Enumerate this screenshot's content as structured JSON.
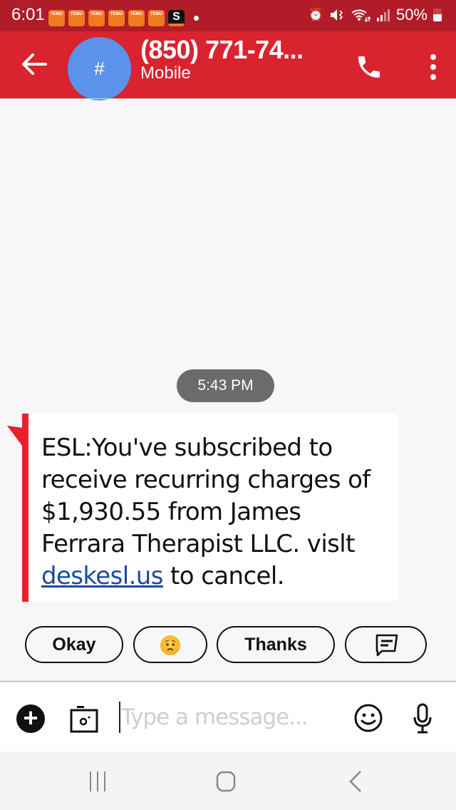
{
  "status_bar": {
    "time": "6:01",
    "notification_icons": [
      "temu-icon",
      "temu-icon",
      "temu-icon",
      "temu-icon",
      "temu-icon",
      "temu-icon",
      "s-tv-icon"
    ],
    "temu_label": "TEMU",
    "s_label": "S",
    "battery": "50%",
    "system_icons": [
      "alarm-icon",
      "mute-icon",
      "wifi-icon",
      "signal-icon",
      "battery-icon"
    ]
  },
  "header": {
    "avatar_text": "#",
    "title": "(850) 771-74...",
    "subtitle": "Mobile",
    "back_icon": "arrow-left-icon",
    "call_icon": "phone-icon",
    "more_icon": "more-vertical-icon",
    "accent_color": "#d9232f"
  },
  "conversation": {
    "timestamp": "5:43 PM",
    "messages": [
      {
        "text_before_link": "ESL:You've subscribed to receive recurring charges of $1,930.55 from James Ferrara Therapist LLC. vislt ",
        "link_text": "deskesl.us",
        "text_after_link": " to cancel.",
        "direction": "incoming"
      }
    ]
  },
  "smart_replies": [
    {
      "label": "Okay",
      "type": "text"
    },
    {
      "label": "worried-face-emoji",
      "type": "emoji"
    },
    {
      "label": "Thanks",
      "type": "text"
    },
    {
      "label": "message-compose-icon",
      "type": "icon"
    }
  ],
  "composer": {
    "placeholder": "Type a message...",
    "value": "",
    "icons": [
      "plus-icon",
      "camera-icon",
      "emoji-icon",
      "mic-icon"
    ]
  },
  "nav_bar": {
    "buttons": [
      "recents-icon",
      "home-icon",
      "back-icon"
    ]
  }
}
